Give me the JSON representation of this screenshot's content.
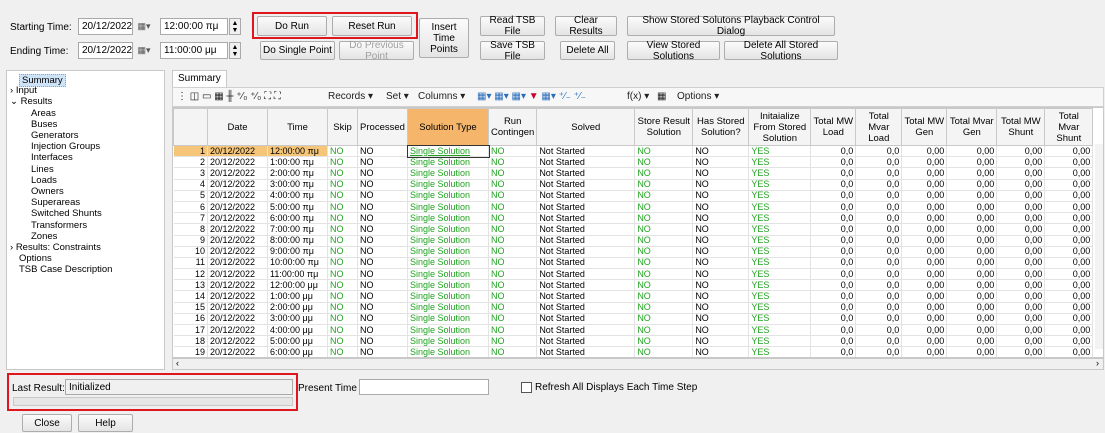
{
  "time_controls": {
    "starting_label": "Starting Time:",
    "starting_date": "20/12/2022",
    "starting_time": "12:00:00 πμ",
    "ending_label": "Ending Time:",
    "ending_date": "20/12/2022",
    "ending_time": "11:00:00 μμ"
  },
  "buttons": {
    "do_run": "Do Run",
    "reset_run": "Reset Run",
    "do_single_point": "Do Single Point",
    "do_previous_point": "Do Previous Point",
    "insert_time_points": "Insert Time Points",
    "read_tsb": "Read TSB File",
    "save_tsb": "Save TSB File",
    "clear_results": "Clear Results",
    "delete_all": "Delete All",
    "show_playback": "Show Stored Solutons Playback Control Dialog",
    "view_stored": "View Stored Solutions",
    "delete_all_stored": "Delete All Stored Solutions",
    "close": "Close",
    "help": "Help"
  },
  "tree": [
    {
      "label": "Summary",
      "level": 1,
      "selected": true
    },
    {
      "label": "Input",
      "level": 0,
      "arrow": ">"
    },
    {
      "label": "Results",
      "level": 0,
      "arrow": "v"
    },
    {
      "label": "Areas",
      "level": 2
    },
    {
      "label": "Buses",
      "level": 2
    },
    {
      "label": "Generators",
      "level": 2
    },
    {
      "label": "Injection Groups",
      "level": 2
    },
    {
      "label": "Interfaces",
      "level": 2
    },
    {
      "label": "Lines",
      "level": 2
    },
    {
      "label": "Loads",
      "level": 2
    },
    {
      "label": "Owners",
      "level": 2
    },
    {
      "label": "Superareas",
      "level": 2
    },
    {
      "label": "Switched Shunts",
      "level": 2
    },
    {
      "label": "Transformers",
      "level": 2
    },
    {
      "label": "Zones",
      "level": 2
    },
    {
      "label": "Results: Constraints",
      "level": 0,
      "arrow": ">"
    },
    {
      "label": "Options",
      "level": 1
    },
    {
      "label": "TSB Case Description",
      "level": 1
    }
  ],
  "tab": "Summary",
  "toolbar": {
    "records": "Records ▾",
    "set": "Set ▾",
    "columns": "Columns ▾",
    "options": "Options ▾",
    "fx": "f(x) ▾"
  },
  "columns": [
    "",
    "Date",
    "Time",
    "Skip",
    "Processed",
    "Solution Type",
    "Run Contingen",
    "Solved",
    "Store Result Solution",
    "Has Stored Solution?",
    "Initaialize From Stored Solution",
    "Total MW Load",
    "Total Mvar Load",
    "Total MW Gen",
    "Total Mvar Gen",
    "Total MW Shunt",
    "Total Mvar Shunt"
  ],
  "rows": [
    {
      "n": "1",
      "date": "20/12/2022",
      "time": "12:00:00 πμ"
    },
    {
      "n": "2",
      "date": "20/12/2022",
      "time": "1:00:00 πμ"
    },
    {
      "n": "3",
      "date": "20/12/2022",
      "time": "2:00:00 πμ"
    },
    {
      "n": "4",
      "date": "20/12/2022",
      "time": "3:00:00 πμ"
    },
    {
      "n": "5",
      "date": "20/12/2022",
      "time": "4:00:00 πμ"
    },
    {
      "n": "6",
      "date": "20/12/2022",
      "time": "5:00:00 πμ"
    },
    {
      "n": "7",
      "date": "20/12/2022",
      "time": "6:00:00 πμ"
    },
    {
      "n": "8",
      "date": "20/12/2022",
      "time": "7:00:00 πμ"
    },
    {
      "n": "9",
      "date": "20/12/2022",
      "time": "8:00:00 πμ"
    },
    {
      "n": "10",
      "date": "20/12/2022",
      "time": "9:00:00 πμ"
    },
    {
      "n": "11",
      "date": "20/12/2022",
      "time": "10:00:00 πμ"
    },
    {
      "n": "12",
      "date": "20/12/2022",
      "time": "11:00:00 πμ"
    },
    {
      "n": "13",
      "date": "20/12/2022",
      "time": "12:00:00 μμ"
    },
    {
      "n": "14",
      "date": "20/12/2022",
      "time": "1:00:00 μμ"
    },
    {
      "n": "15",
      "date": "20/12/2022",
      "time": "2:00:00 μμ"
    },
    {
      "n": "16",
      "date": "20/12/2022",
      "time": "3:00:00 μμ"
    },
    {
      "n": "17",
      "date": "20/12/2022",
      "time": "4:00:00 μμ"
    },
    {
      "n": "18",
      "date": "20/12/2022",
      "time": "5:00:00 μμ"
    },
    {
      "n": "19",
      "date": "20/12/2022",
      "time": "6:00:00 μμ"
    }
  ],
  "row_defaults": {
    "skip": "NO",
    "processed": "NO",
    "solution_type": "Single Solution",
    "run_cont": "NO",
    "solved": "Not Started",
    "store": "NO",
    "has_stored": "NO",
    "init": "YES",
    "mw_load": "0,0",
    "mvar_load": "0,0",
    "mw_gen": "0,00",
    "mvar_gen": "0,00",
    "mw_shunt": "0,00",
    "mvar_shunt": "0,00"
  },
  "status": {
    "last_result_label": "Last Result:",
    "last_result_value": "Initialized",
    "present_time_label": "Present Time",
    "present_time_value": "",
    "refresh_label": "Refresh All Displays Each Time Step"
  },
  "colors": {
    "highlight_red": "#e0161e",
    "header_orange": "#f5b66c",
    "yes_no_green": "#1fa31f"
  }
}
